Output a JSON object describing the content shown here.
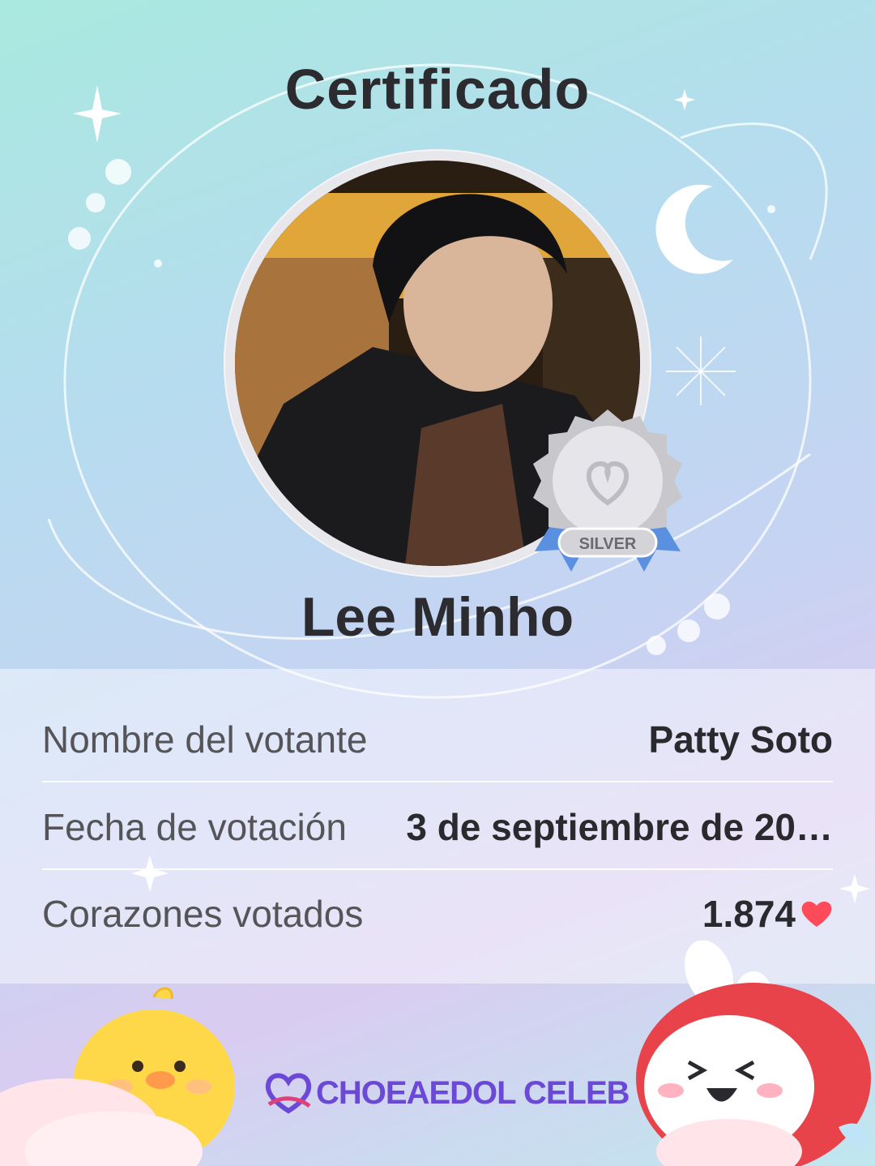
{
  "certificate": {
    "title": "Certificado",
    "artist_name": "Lee Minho",
    "medal_label": "SILVER"
  },
  "details": {
    "voter_label": "Nombre del votante",
    "voter_value": "Patty Soto",
    "date_label": "Fecha de votación",
    "date_value": "3 de septiembre de 20…",
    "hearts_label": "Corazones votados",
    "hearts_value": "1.874"
  },
  "brand": {
    "name": "CHOEAEDOL CELEB"
  },
  "colors": {
    "heart": "#ff4a5a",
    "brand": "#6b48d6",
    "ribbon": "#5b8fe0"
  }
}
